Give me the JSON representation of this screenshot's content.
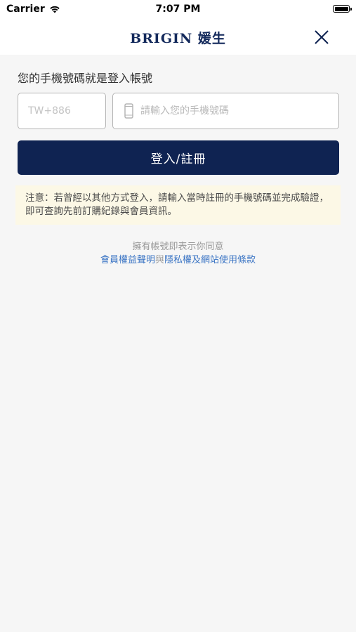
{
  "status_bar": {
    "carrier": "Carrier",
    "time": "7:07 PM"
  },
  "header": {
    "brand": "BRIGIN 媛生",
    "close_icon": "close-icon"
  },
  "login": {
    "prompt": "您的手機號碼就是登入帳號",
    "country_code": "TW+886",
    "phone_placeholder": "請輸入您的手機號碼",
    "phone_value": "",
    "submit_label": "登入/註冊"
  },
  "notice": {
    "text": "注意：若曾經以其他方式登入，請輸入當時註冊的手機號碼並完成驗證，即可查詢先前訂購紀錄與會員資訊。"
  },
  "terms": {
    "intro": "擁有帳號即表示你同意",
    "link_member": "會員權益聲明",
    "conjunction": "與",
    "link_privacy": "隱私權及網站使用條款"
  },
  "colors": {
    "primary": "#0f2352",
    "brand": "#142a5c",
    "link": "#3a74c4",
    "notice_bg": "#fcf8e6",
    "page_bg": "#f6f6f6"
  }
}
